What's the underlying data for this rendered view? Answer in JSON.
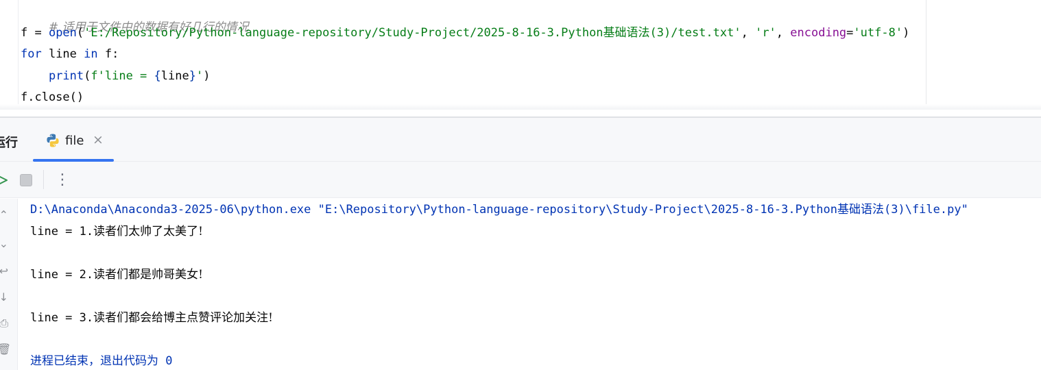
{
  "editor": {
    "lines": [
      {
        "comment": "# 适用于文件中的数据有好几行的情况"
      },
      {
        "var": "f = ",
        "func": "open",
        "open_paren": "(",
        "path": "'E:/Repository/Python-language-repository/Study-Project/2025-8-16-3.Python基础语法(3)/test.txt'",
        "sep1": ", ",
        "mode": "'r'",
        "sep2": ", ",
        "param": "encoding",
        "eq": "=",
        "enc": "'utf-8'",
        "close_paren": ")"
      },
      {
        "kw_for": "for",
        "mid": " line ",
        "kw_in": "in",
        "tail": " f:"
      },
      {
        "indent": "    ",
        "func": "print",
        "open": "(",
        "fstr_start": "f'line = ",
        "brace_open": "{",
        "var": "line",
        "brace_close": "}",
        "fstr_end": "'",
        "close": ")"
      },
      {
        "text": "f.close()"
      }
    ]
  },
  "run_window": {
    "title": "运行",
    "tab_label": "file",
    "tab_close": "×",
    "more_glyph": "⋮"
  },
  "console": {
    "command": "D:\\Anaconda\\Anaconda3-2025-06\\python.exe \"E:\\Repository\\Python-language-repository\\Study-Project\\2025-8-16-3.Python基础语法(3)\\file.py\"",
    "lines": [
      {
        "prefix": "line = 1.",
        "cjk": "读者们太帅了太美了!"
      },
      {
        "prefix": "line = 2.",
        "cjk": "读者们都是帅哥美女!"
      },
      {
        "prefix": "line = 3.",
        "cjk": "读者们都会给博主点赞评论加关注!"
      }
    ],
    "exit_text": "进程已结束，退出代码为",
    "exit_code": " 0"
  },
  "colors": {
    "keyword": "#0033b3",
    "string": "#067d17",
    "comment": "#8c8c8c",
    "param": "#871094",
    "accent": "#3574f0"
  }
}
